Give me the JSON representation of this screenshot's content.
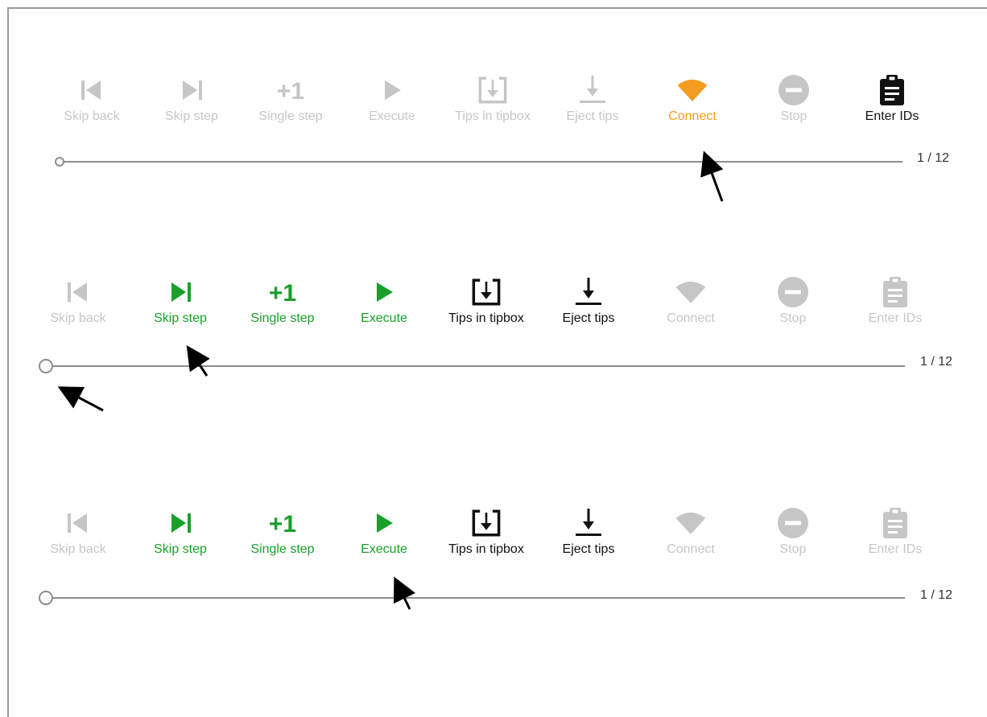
{
  "panels": [
    {
      "buttons": [
        {
          "label": "Skip back",
          "icon": "skip-back-icon",
          "state": "disabled"
        },
        {
          "label": "Skip step",
          "icon": "skip-step-icon",
          "state": "disabled"
        },
        {
          "label": "Single step",
          "icon": "plus-one-icon",
          "state": "disabled"
        },
        {
          "label": "Execute",
          "icon": "play-icon",
          "state": "disabled"
        },
        {
          "label": "Tips in tipbox",
          "icon": "tipbox-icon",
          "state": "disabled"
        },
        {
          "label": "Eject tips",
          "icon": "eject-icon",
          "state": "disabled"
        },
        {
          "label": "Connect",
          "icon": "wifi-icon",
          "state": "active-orange"
        },
        {
          "label": "Stop",
          "icon": "stop-icon",
          "state": "disabled"
        },
        {
          "label": "Enter IDs",
          "icon": "clipboard-icon",
          "state": "enabled"
        }
      ],
      "progress": {
        "text": "1 / 12",
        "current": 1,
        "total": 12
      }
    },
    {
      "buttons": [
        {
          "label": "Skip back",
          "icon": "skip-back-icon",
          "state": "disabled"
        },
        {
          "label": "Skip step",
          "icon": "skip-step-icon",
          "state": "active-green"
        },
        {
          "label": "Single step",
          "icon": "plus-one-icon",
          "state": "active-green"
        },
        {
          "label": "Execute",
          "icon": "play-icon",
          "state": "active-green"
        },
        {
          "label": "Tips in tipbox",
          "icon": "tipbox-icon",
          "state": "enabled"
        },
        {
          "label": "Eject tips",
          "icon": "eject-icon",
          "state": "enabled"
        },
        {
          "label": "Connect",
          "icon": "wifi-icon",
          "state": "disabled"
        },
        {
          "label": "Stop",
          "icon": "stop-icon",
          "state": "disabled"
        },
        {
          "label": "Enter IDs",
          "icon": "clipboard-icon",
          "state": "disabled"
        }
      ],
      "progress": {
        "text": "1 / 12",
        "current": 1,
        "total": 12
      }
    },
    {
      "buttons": [
        {
          "label": "Skip back",
          "icon": "skip-back-icon",
          "state": "disabled"
        },
        {
          "label": "Skip step",
          "icon": "skip-step-icon",
          "state": "active-green"
        },
        {
          "label": "Single step",
          "icon": "plus-one-icon",
          "state": "active-green"
        },
        {
          "label": "Execute",
          "icon": "play-icon",
          "state": "active-green"
        },
        {
          "label": "Tips in tipbox",
          "icon": "tipbox-icon",
          "state": "enabled"
        },
        {
          "label": "Eject tips",
          "icon": "eject-icon",
          "state": "enabled"
        },
        {
          "label": "Connect",
          "icon": "wifi-icon",
          "state": "disabled"
        },
        {
          "label": "Stop",
          "icon": "stop-icon",
          "state": "disabled"
        },
        {
          "label": "Enter IDs",
          "icon": "clipboard-icon",
          "state": "disabled"
        }
      ],
      "progress": {
        "text": "1 / 12",
        "current": 1,
        "total": 12
      }
    }
  ],
  "colors": {
    "disabled": "#c6c6c6",
    "green": "#18a02b",
    "orange": "#f39c1f",
    "black": "#111111",
    "track": "#8c8c8c"
  }
}
